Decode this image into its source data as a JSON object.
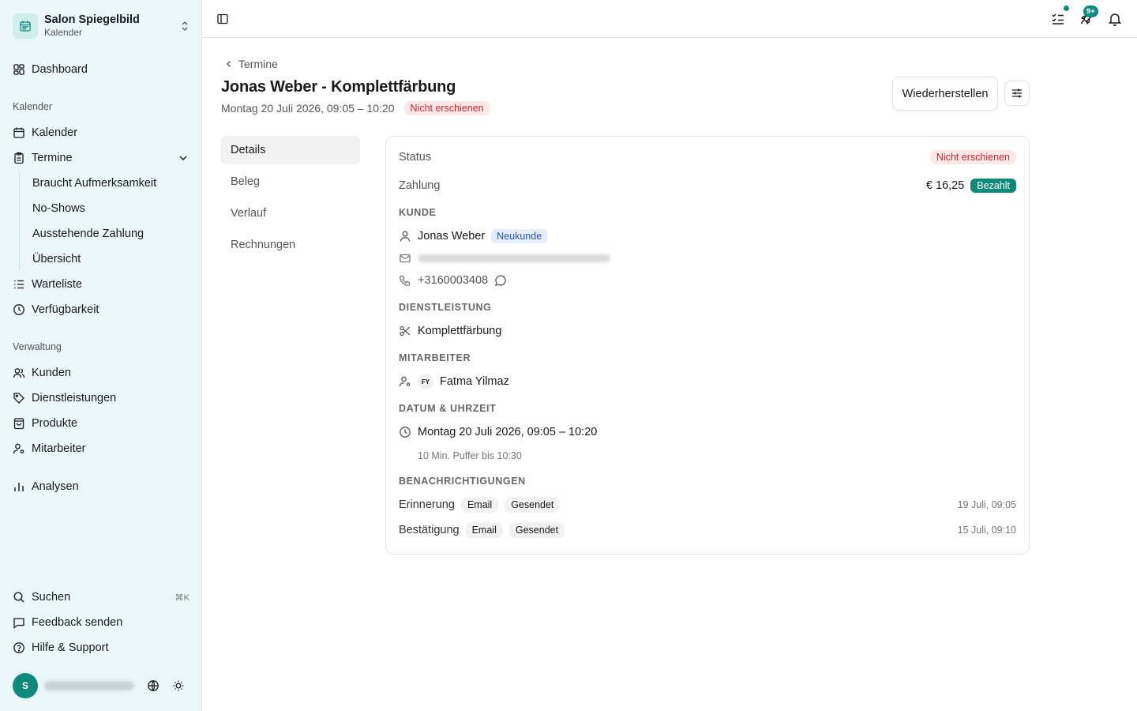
{
  "sidebar": {
    "brand": {
      "name": "Salon Spiegelbild",
      "sub": "Kalender"
    },
    "dashboard": "Dashboard",
    "section_kalender": "Kalender",
    "kalender": "Kalender",
    "termine": "Termine",
    "termine_sub": [
      "Braucht Aufmerksamkeit",
      "No-Shows",
      "Ausstehende Zahlung",
      "Übersicht"
    ],
    "warteliste": "Warteliste",
    "verfuegbarkeit": "Verfügbarkeit",
    "section_verwaltung": "Verwaltung",
    "kunden": "Kunden",
    "dienstleistungen": "Dienstleistungen",
    "produkte": "Produkte",
    "mitarbeiter": "Mitarbeiter",
    "analysen": "Analysen",
    "suchen": "Suchen",
    "suchen_kbd": "⌘K",
    "feedback": "Feedback senden",
    "hilfe": "Hilfe & Support",
    "avatar_initial": "S"
  },
  "topbar": {
    "badge": "9+"
  },
  "page": {
    "back": "Termine",
    "title": "Jonas Weber - Komplettfärbung",
    "subtitle": "Montag 20 Juli 2026, 09:05 – 10:20",
    "status_pill": "Nicht erschienen",
    "restore_button": "Wiederherstellen"
  },
  "tabs": [
    "Details",
    "Beleg",
    "Verlauf",
    "Rechnungen"
  ],
  "details": {
    "status_label": "Status",
    "status_value": "Nicht erschienen",
    "payment_label": "Zahlung",
    "payment_amount": "€ 16,25",
    "payment_status": "Bezahlt",
    "kunde_header": "KUNDE",
    "customer_name": "Jonas Weber",
    "customer_badge": "Neukunde",
    "customer_phone": "+3160003408",
    "service_header": "DIENSTLEISTUNG",
    "service_name": "Komplettfärbung",
    "staff_header": "MITARBEITER",
    "staff_initials": "FY",
    "staff_name": "Fatma Yilmaz",
    "datetime_header": "DATUM & UHRZEIT",
    "datetime_value": "Montag 20 Juli 2026, 09:05 – 10:20",
    "buffer": "10 Min. Puffer bis 10:30",
    "notifications_header": "BENACHRICHTIGUNGEN",
    "notifications": [
      {
        "type": "Erinnerung",
        "channel": "Email",
        "state": "Gesendet",
        "time": "19 Juli, 09:05"
      },
      {
        "type": "Bestätigung",
        "channel": "Email",
        "state": "Gesendet",
        "time": "15 Juli, 09:10"
      }
    ]
  },
  "colors": {
    "accent": "#0f8a7a",
    "sidebar_bg": "#eaf6f9",
    "danger": "#c9242c"
  }
}
